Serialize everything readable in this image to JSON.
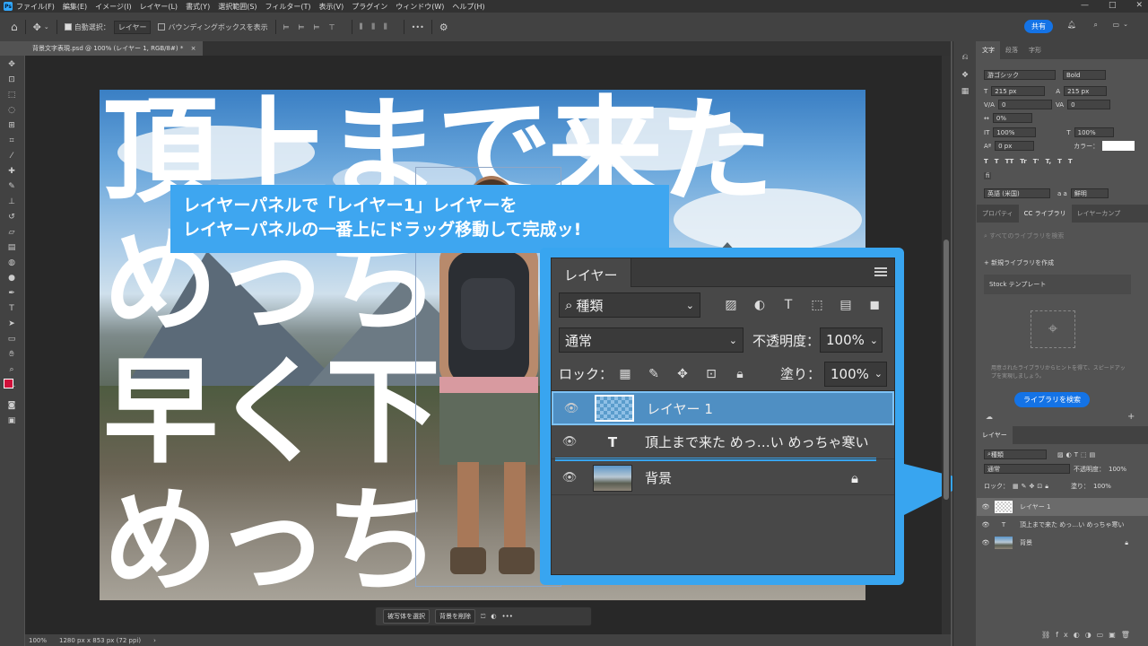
{
  "menubar": {
    "app_badge": "Ps",
    "items": [
      "ファイル(F)",
      "編集(E)",
      "イメージ(I)",
      "レイヤー(L)",
      "書式(Y)",
      "選択範囲(S)",
      "フィルター(T)",
      "表示(V)",
      "プラグイン",
      "ウィンドウ(W)",
      "ヘルプ(H)"
    ],
    "window_buttons": [
      "—",
      "□",
      "✕"
    ]
  },
  "options": {
    "auto_select_label": "自動選択：",
    "auto_select_value": "レイヤー",
    "show_transform_label": "バウンディングボックスを表示",
    "more": "•••",
    "share": "共有"
  },
  "document": {
    "tab_title": "背景文字表現.psd @ 100% (レイヤー 1, RGB/8#) *",
    "tab_close": "×"
  },
  "canvas": {
    "big_text": [
      "頂上まで来た",
      "めっちゃ",
      "早く下",
      "めっち"
    ]
  },
  "callout": {
    "line1": "レイヤーパネルで「レイヤー1」レイヤーを",
    "line2": "レイヤーパネルの一番上にドラッグ移動して完成ッ!"
  },
  "zoom_panel": {
    "tab": "レイヤー",
    "filter_kind": "種類",
    "blend_mode": "通常",
    "opacity_label": "不透明度：",
    "opacity_value": "100%",
    "lock_label": "ロック：",
    "fill_label": "塗り：",
    "fill_value": "100%",
    "layers": [
      {
        "name": "レイヤー 1",
        "selected": true
      },
      {
        "name": "頂上まで来た めっ…い めっちゃ寒い",
        "type": "text"
      },
      {
        "name": "背景",
        "locked": true
      }
    ]
  },
  "char_panel": {
    "tabs": [
      "文字",
      "段落",
      "字形"
    ],
    "font": "游ゴシック",
    "style": "Bold",
    "size": "215 px",
    "leading": "215 px",
    "kerning": "0",
    "tracking": "0",
    "tsume": "0%",
    "vscale": "100%",
    "hscale": "100%",
    "baseline": "0 px",
    "color_label": "カラー：",
    "style_buttons": [
      "T",
      "T",
      "TT",
      "Tr",
      "T'",
      "T,",
      "T",
      "T"
    ],
    "lang": "英語 (米国)",
    "aa": "鮮明",
    "aa_prefix": "a a",
    "frac": "ﬁ"
  },
  "lib_panel": {
    "tabs": [
      "プロパティ",
      "CC ライブラリ",
      "レイヤーカンプ"
    ],
    "search": "すべてのライブラリを検索",
    "new_lib": "新規ライブラリを作成",
    "stock": "Stock テンプレート",
    "hint": "用意されたライブラリからヒントを得て、スピードアップを実現しましょう。",
    "browse": "ライブラリを検索"
  },
  "layers_panel": {
    "tab": "レイヤー",
    "kind": "種類",
    "blend": "通常",
    "opacity_label": "不透明度：",
    "opacity": "100%",
    "lock_label": "ロック：",
    "fill_label": "塗り：",
    "fill": "100%",
    "layers": [
      "レイヤー 1",
      "頂上まで来た めっ…い めっちゃ寒い",
      "背景"
    ]
  },
  "status": {
    "zoom": "100%",
    "size": "1280 px x 853 px (72 ppi)",
    "arrow": "›"
  },
  "context_bar": {
    "select_subject": "被写体を選択",
    "remove_bg": "背景を削除"
  },
  "colors": {
    "accent": "#3ea6f0",
    "foreground": "#d0103a",
    "share": "#1473e6"
  }
}
